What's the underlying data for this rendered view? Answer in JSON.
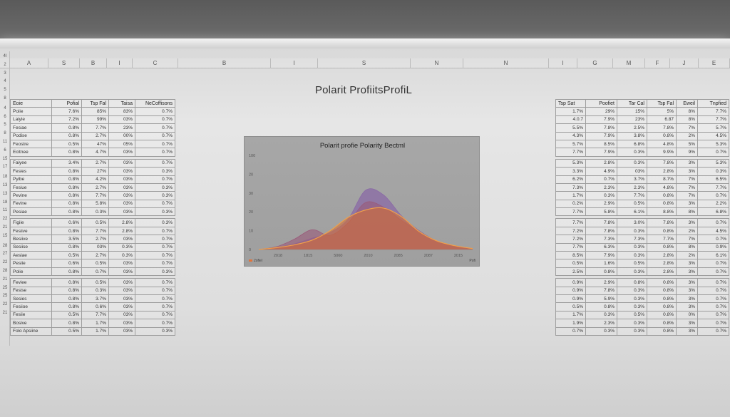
{
  "sheet_title": "Polarit ProfiitsProfiL",
  "column_headers": [
    {
      "label": "A"
    },
    {
      "label": "S"
    },
    {
      "label": "B"
    },
    {
      "label": "I"
    },
    {
      "label": "C"
    },
    {
      "label": "B"
    },
    {
      "label": "I"
    },
    {
      "label": "S"
    },
    {
      "label": "N"
    },
    {
      "label": "N"
    },
    {
      "label": "I"
    },
    {
      "label": "G"
    },
    {
      "label": "M"
    },
    {
      "label": "F"
    },
    {
      "label": "J"
    },
    {
      "label": "E"
    }
  ],
  "row_numbers": [
    "4I",
    "2",
    "3",
    "4",
    "5",
    "8",
    "4",
    "6",
    "5",
    "8",
    "11",
    "6",
    "15",
    "17",
    "18",
    "13",
    "13",
    "18",
    "11",
    "22",
    "21",
    "15",
    "28",
    "27",
    "22",
    "28",
    "21",
    "25",
    "25",
    "22",
    "21"
  ],
  "left_table": {
    "headers": [
      "Eoie",
      "Pofial",
      "Tsp Fal",
      "Taisa",
      "NeCoffisons"
    ],
    "rows": [
      [
        "Poiie",
        "7.6%",
        "85%",
        "83%",
        "0.7%"
      ],
      [
        "Laiyie",
        "7.2%",
        "99%",
        "03%",
        "0.7%"
      ],
      [
        "Fesiae",
        "0.8%",
        "7.7%",
        "23%",
        "0.7%"
      ],
      [
        "Podise",
        "0.8%",
        "2.7%",
        "00%",
        "0.7%"
      ],
      [
        "Feostre",
        "0.5%",
        "47%",
        "05%",
        "0.7%"
      ],
      [
        "Ecitnee",
        "0.8%",
        "4.7%",
        "03%",
        "0.7%"
      ],
      null,
      [
        "Faiyee",
        "3.4%",
        "2.7%",
        "03%",
        "0.7%"
      ],
      [
        "Fesies",
        "0.8%",
        "27%",
        "03%",
        "0.3%"
      ],
      [
        "Pyibe",
        "0.8%",
        "4.2%",
        "03%",
        "0.7%"
      ],
      [
        "Fesiue",
        "0.8%",
        "2.7%",
        "03%",
        "0.3%"
      ],
      [
        "Pevine",
        "0.8%",
        "7.7%",
        "03%",
        "0.3%"
      ],
      [
        "Fevine",
        "0.8%",
        "5.8%",
        "03%",
        "0.7%"
      ],
      [
        "Pesiae",
        "0.8%",
        "0.3%",
        "03%",
        "0.3%"
      ],
      null,
      [
        "Figiie",
        "0.6%",
        "0.5%",
        "2.8%",
        "0.3%"
      ],
      [
        "Fesiive",
        "0.8%",
        "7.7%",
        "2.8%",
        "0.7%"
      ],
      [
        "Besiive",
        "3.5%",
        "2.7%",
        "03%",
        "0.7%"
      ],
      [
        "Sesiise",
        "0.8%",
        "03%",
        "0.3%",
        "0.7%"
      ],
      [
        "Aesiae",
        "0.5%",
        "2.7%",
        "0.3%",
        "0.7%"
      ],
      [
        "Pesiie",
        "0.6%",
        "0.5%",
        "03%",
        "0.7%"
      ],
      [
        "Polie",
        "0.8%",
        "0.7%",
        "03%",
        "0.3%"
      ],
      null,
      [
        "Feviee",
        "0.8%",
        "0.5%",
        "03%",
        "0.7%"
      ],
      [
        "Fesise",
        "0.8%",
        "0.3%",
        "03%",
        "0.7%"
      ],
      [
        "Sesies",
        "0.8%",
        "3.7%",
        "03%",
        "0.7%"
      ],
      [
        "Fesiioe",
        "0.8%",
        "0.6%",
        "03%",
        "0.7%"
      ],
      [
        "Fesiie",
        "0.5%",
        "7.7%",
        "03%",
        "0.7%"
      ],
      [
        "Bosive",
        "0.8%",
        "1.7%",
        "03%",
        "0.7%"
      ],
      [
        "Folo Apsiine",
        "0.5%",
        "1.7%",
        "03%",
        "0.3%"
      ]
    ]
  },
  "right_table": {
    "headers": [
      "Tsp Sat",
      "Poofiet",
      "Tar Cal",
      "Tsp Fal",
      "Eweil",
      "Tnpfied"
    ],
    "rows": [
      [
        "1.7%",
        "29%",
        "15%",
        "5%",
        "8%",
        "7.7%"
      ],
      [
        "4.0.7",
        "7.9%",
        "23%",
        "6.87",
        "8%",
        "7.7%"
      ],
      [
        "5.5%",
        "7.8%",
        "2.5%",
        "7.8%",
        "7%",
        "5.7%"
      ],
      [
        "4.3%",
        "7.9%",
        "3.8%",
        "0.8%",
        "2%",
        "4.5%"
      ],
      [
        "5.7%",
        "8.5%",
        "6.8%",
        "4.8%",
        "5%",
        "5.3%"
      ],
      [
        "7.7%",
        "7.9%",
        "0.3%",
        "9.9%",
        "9%",
        "0.7%"
      ],
      null,
      [
        "5.3%",
        "2.8%",
        "0.3%",
        "7.8%",
        "3%",
        "5.3%"
      ],
      [
        "3.3%",
        "4.9%",
        "03%",
        "2.8%",
        "3%",
        "0.3%"
      ],
      [
        "6.2%",
        "0.7%",
        "3.7%",
        "8.7%",
        "7%",
        "6.5%"
      ],
      [
        "7.3%",
        "2.3%",
        "2.3%",
        "4.8%",
        "7%",
        "7.7%"
      ],
      [
        "1.7%",
        "0.3%",
        "7.7%",
        "0.8%",
        "7%",
        "0.7%"
      ],
      [
        "0.2%",
        "2.9%",
        "0.5%",
        "0.8%",
        "3%",
        "2.2%"
      ],
      [
        "7.7%",
        "5.8%",
        "6.1%",
        "8.8%",
        "8%",
        "6.8%"
      ],
      null,
      [
        "7.7%",
        "7.8%",
        "3.0%",
        "7.8%",
        "3%",
        "0.7%"
      ],
      [
        "7.2%",
        "7.8%",
        "0.3%",
        "0.8%",
        "2%",
        "4.5%"
      ],
      [
        "7.2%",
        "7.3%",
        "7.3%",
        "7.7%",
        "7%",
        "0.7%"
      ],
      [
        "7.7%",
        "6.3%",
        "0.3%",
        "0.8%",
        "8%",
        "0.9%"
      ],
      [
        "8.5%",
        "7.9%",
        "0.3%",
        "2.8%",
        "2%",
        "6.1%"
      ],
      [
        "0.5%",
        "1.6%",
        "0.5%",
        "2.8%",
        "3%",
        "0.7%"
      ],
      [
        "2.5%",
        "0.8%",
        "0.3%",
        "2.8%",
        "3%",
        "0.7%"
      ],
      null,
      [
        "0.9%",
        "2.9%",
        "0.8%",
        "0.8%",
        "3%",
        "0.7%"
      ],
      [
        "0.9%",
        "7.8%",
        "0.3%",
        "0.8%",
        "3%",
        "0.7%"
      ],
      [
        "0.9%",
        "5.9%",
        "0.3%",
        "0.8%",
        "3%",
        "0.7%"
      ],
      [
        "0.5%",
        "0.8%",
        "0.3%",
        "0.8%",
        "3%",
        "0.7%"
      ],
      [
        "1.7%",
        "0.3%",
        "0.5%",
        "0.8%",
        "0%",
        "0.7%"
      ],
      [
        "1.9%",
        "2.3%",
        "0.3%",
        "0.8%",
        "3%",
        "0.7%"
      ],
      [
        "0.7%",
        "0.3%",
        "0.3%",
        "0.8%",
        "3%",
        "0.7%"
      ]
    ]
  },
  "chart_data": {
    "type": "area",
    "title": "Polarit profie Polarity Bectml",
    "x_ticks": [
      "2018",
      "1815",
      "5060",
      "2010",
      "2085",
      "2087",
      "2015"
    ],
    "y_ticks": [
      "0",
      "10",
      "20",
      "30",
      "20",
      "100"
    ],
    "ylim": [
      0,
      100
    ],
    "x": [
      0,
      1,
      2,
      3,
      4,
      5,
      6,
      7,
      8,
      9,
      10,
      11,
      12
    ],
    "series": [
      {
        "color": "#8a6aa6",
        "values": [
          0,
          2,
          6,
          12,
          18,
          32,
          63,
          58,
          36,
          20,
          9,
          4,
          1
        ]
      },
      {
        "color": "#9a5a7a",
        "values": [
          0,
          3,
          11,
          21,
          15,
          28,
          50,
          45,
          31,
          19,
          9,
          4,
          1
        ]
      },
      {
        "color": "#d8702e",
        "values": [
          0,
          2,
          5,
          10,
          20,
          34,
          42,
          44,
          35,
          19,
          9,
          4,
          1
        ]
      }
    ],
    "legend_left": "2ofiel",
    "legend_right": "Pofi",
    "colors": {
      "purple": "#8a6aa6",
      "magenta": "#9a5a7a",
      "orange": "#d8702e",
      "background": "#a3a3a3"
    }
  }
}
